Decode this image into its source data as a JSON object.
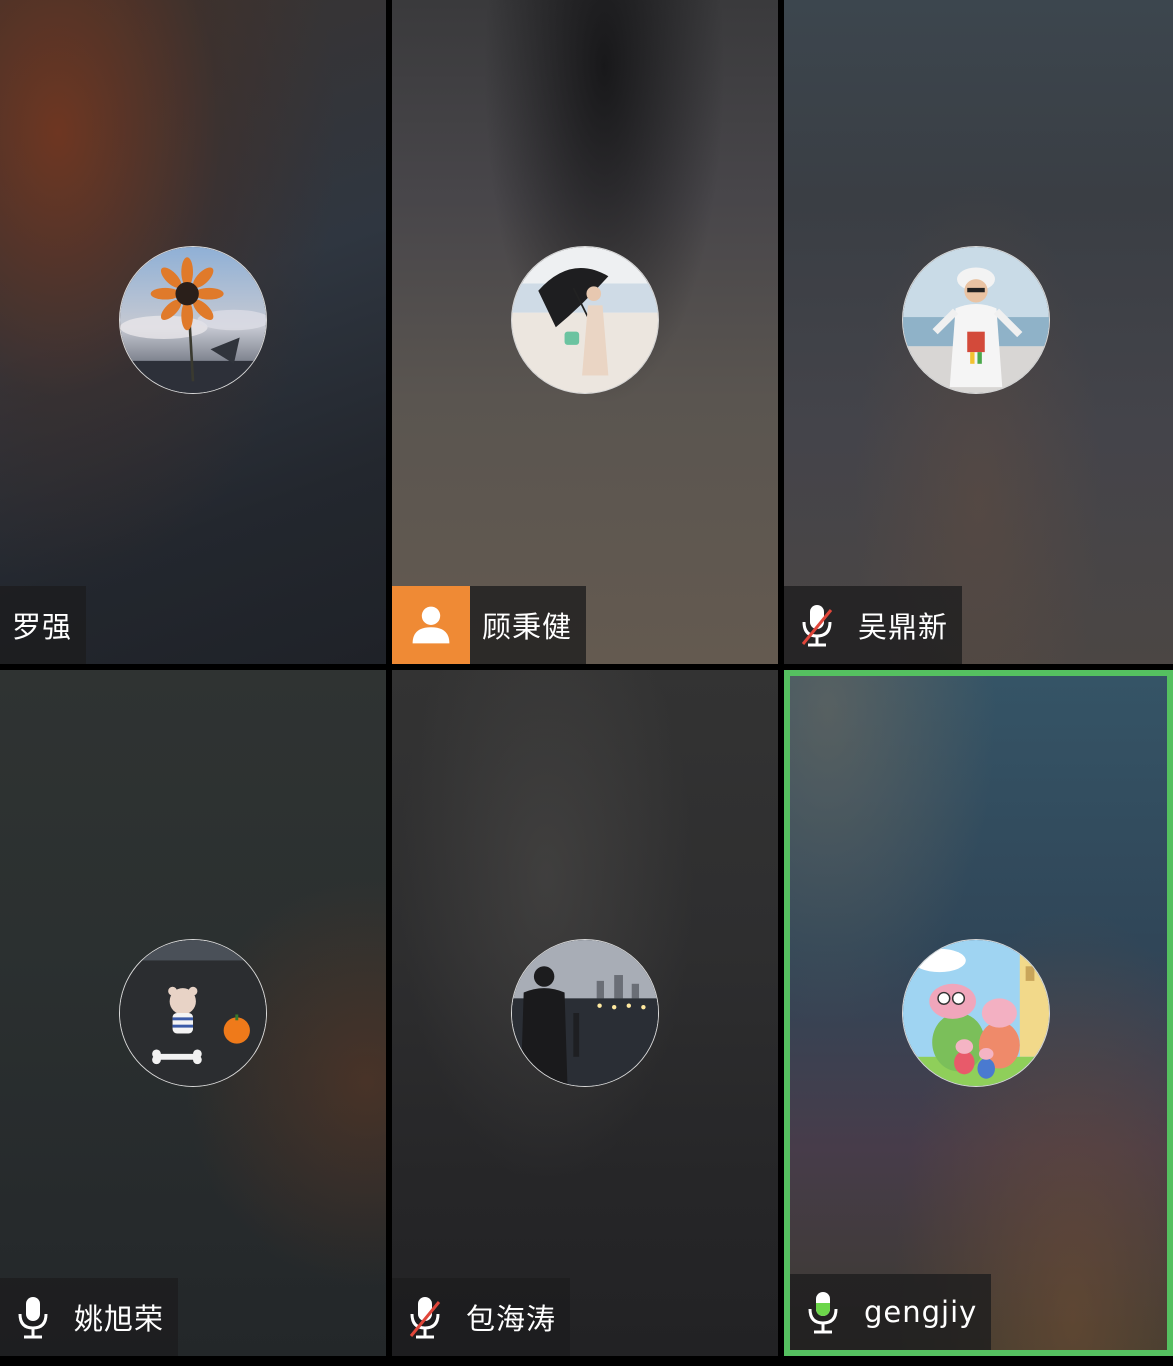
{
  "participants": [
    {
      "name": "罗强",
      "role": "participant",
      "mic": "none"
    },
    {
      "name": "顾秉健",
      "role": "host",
      "mic": "none"
    },
    {
      "name": "吴鼎新",
      "role": "participant",
      "mic": "muted"
    },
    {
      "name": "姚旭荣",
      "role": "participant",
      "mic": "on"
    },
    {
      "name": "包海涛",
      "role": "participant",
      "mic": "muted"
    },
    {
      "name": "gengjiy",
      "role": "participant",
      "mic": "speaking",
      "active": true
    }
  ],
  "colors": {
    "host_badge": "#ef8a35",
    "active_border": "#55c060",
    "mute_slash": "#e0463a",
    "speaking_mic": "#6cd64a"
  },
  "icons": {
    "host": "person-icon",
    "mic_on": "microphone-icon",
    "mic_muted": "microphone-muted-icon",
    "mic_speaking": "microphone-speaking-icon"
  }
}
